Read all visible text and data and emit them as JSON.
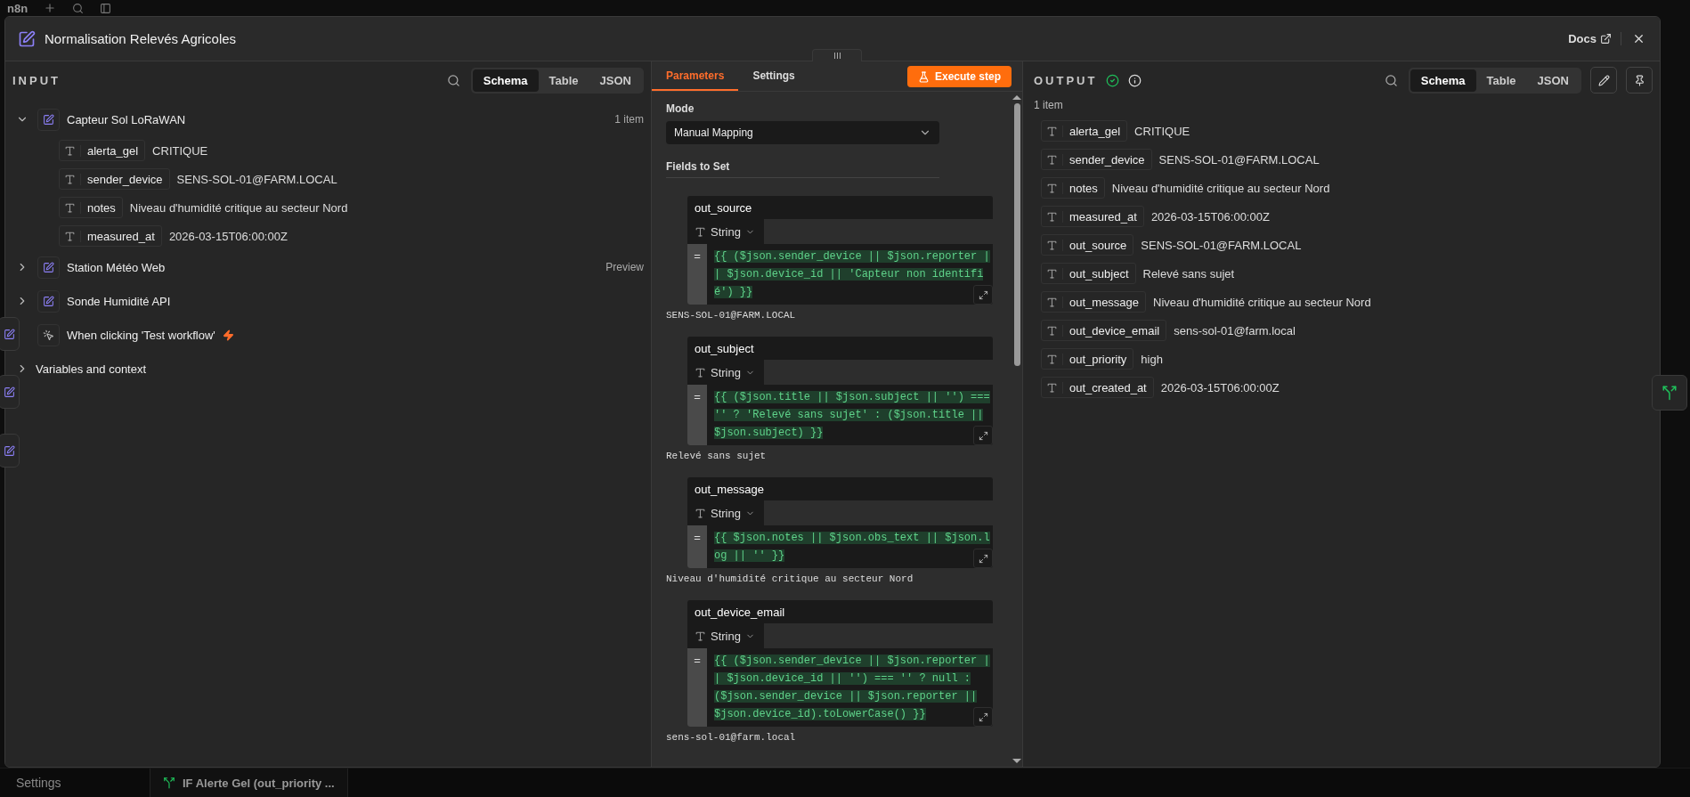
{
  "app_bar": {
    "logo": "n8n"
  },
  "modal": {
    "title": "Normalisation Relevés Agricoles",
    "docs_link": "Docs"
  },
  "input": {
    "label": "INPUT",
    "views": [
      {
        "label": "Schema",
        "selected": true
      },
      {
        "label": "Table",
        "selected": false
      },
      {
        "label": "JSON",
        "selected": false
      }
    ],
    "nodes": [
      {
        "name": "Capteur Sol LoRaWAN",
        "kind": "set",
        "expanded": true,
        "badge": "1 item",
        "fields": [
          {
            "name": "alerta_gel",
            "value": "CRITIQUE"
          },
          {
            "name": "sender_device",
            "value": "SENS-SOL-01@FARM.LOCAL"
          },
          {
            "name": "notes",
            "value": "Niveau d'humidité critique au secteur Nord"
          },
          {
            "name": "measured_at",
            "value": "2026-03-15T06:00:00Z"
          }
        ]
      },
      {
        "name": "Station Météo Web",
        "kind": "set",
        "expanded": false,
        "badge": "Preview"
      },
      {
        "name": "Sonde Humidité API",
        "kind": "set",
        "expanded": false
      },
      {
        "name": "When clicking 'Test workflow'",
        "kind": "trigger"
      }
    ],
    "variables": {
      "label": "Variables and context",
      "expanded": false
    }
  },
  "parameters": {
    "tabs": [
      {
        "label": "Parameters",
        "selected": true
      },
      {
        "label": "Settings",
        "selected": false
      }
    ],
    "execute_button": "Execute step",
    "mode_label": "Mode",
    "mode_value": "Manual Mapping",
    "fields_heading": "Fields to Set",
    "assignments": [
      {
        "name": "out_source",
        "type": "String",
        "prefix": "=",
        "expression": "{{ ($json.sender_device || $json.reporter || $json.device_id || 'Capteur non identifié') }}",
        "result": "SENS-SOL-01@FARM.LOCAL"
      },
      {
        "name": "out_subject",
        "type": "String",
        "prefix": "=",
        "expression": "{{ ($json.title || $json.subject || '') === '' ? 'Relevé sans sujet' : ($json.title || $json.subject) }}",
        "result": "Relevé sans sujet"
      },
      {
        "name": "out_message",
        "type": "String",
        "prefix": "=",
        "expression": "{{ $json.notes || $json.obs_text || $json.log || '' }}",
        "result": "Niveau d'humidité critique au secteur Nord"
      },
      {
        "name": "out_device_email",
        "type": "String",
        "prefix": "=",
        "expression": "{{ ($json.sender_device || $json.reporter || $json.device_id || '') === '' ? null : ($json.sender_device || $json.reporter || $json.device_id).toLowerCase() }}",
        "result": "sens-sol-01@farm.local"
      }
    ]
  },
  "output": {
    "label": "OUTPUT",
    "success": true,
    "views": [
      {
        "label": "Schema",
        "selected": true
      },
      {
        "label": "Table",
        "selected": false
      },
      {
        "label": "JSON",
        "selected": false
      }
    ],
    "count": "1 item",
    "fields": [
      {
        "name": "alerta_gel",
        "value": "CRITIQUE"
      },
      {
        "name": "sender_device",
        "value": "SENS-SOL-01@FARM.LOCAL"
      },
      {
        "name": "notes",
        "value": "Niveau d'humidité critique au secteur Nord"
      },
      {
        "name": "measured_at",
        "value": "2026-03-15T06:00:00Z"
      },
      {
        "name": "out_source",
        "value": "SENS-SOL-01@FARM.LOCAL"
      },
      {
        "name": "out_subject",
        "value": "Relevé sans sujet"
      },
      {
        "name": "out_message",
        "value": "Niveau d'humidité critique au secteur Nord"
      },
      {
        "name": "out_device_email",
        "value": "sens-sol-01@farm.local"
      },
      {
        "name": "out_priority",
        "value": "high"
      },
      {
        "name": "out_created_at",
        "value": "2026-03-15T06:00:00Z"
      }
    ]
  },
  "canvas": {
    "sidebar_footer": "Settings",
    "node_tab": "IF Alerte Gel (out_priority ..."
  }
}
